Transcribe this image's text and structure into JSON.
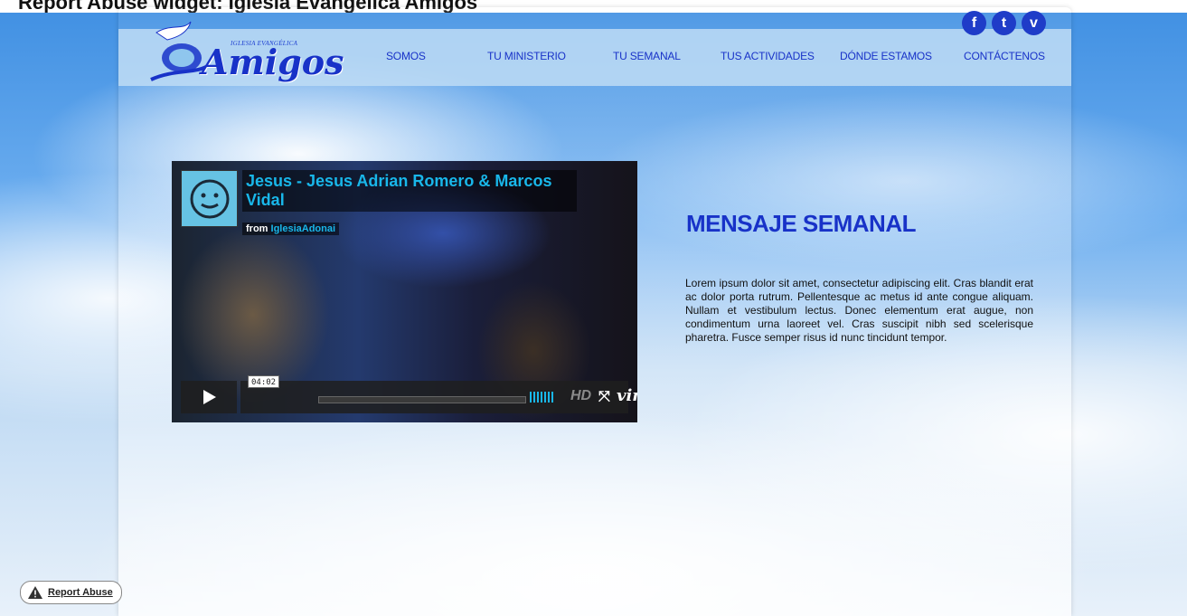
{
  "top_banner": {
    "text": "Report Abuse widget: Iglesia Evangélica Amigos"
  },
  "site": {
    "logo_small": "IGLESIA EVANGÉLICA",
    "logo_big": "Amigos"
  },
  "social": {
    "facebook": "f",
    "twitter": "t",
    "vimeo": "v"
  },
  "nav": [
    "SOMOS",
    "TU MINISTERIO",
    "TU SEMANAL",
    "TUS ACTIVIDADES",
    "DÓNDE ESTAMOS",
    "CONTÁCTENOS"
  ],
  "video": {
    "title": "Jesus - Jesus Adrian Romero & Marcos Vidal",
    "from_label": "from",
    "from_user": "IglesiaAdonai",
    "duration": "04:02",
    "hd_label": "HD",
    "brand": "vimeo"
  },
  "message": {
    "title": "MENSAJE SEMANAL",
    "body": "Lorem ipsum dolor sit amet, consectetur adipiscing elit. Cras blandit erat ac dolor porta rutrum. Pellentesque ac metus id ante congue aliquam. Nullam et vestibulum lectus. Donec elementum erat augue, non condimentum urna laoreet vel. Cras suscipit nibh sed scelerisque pharetra. Fusce semper risus id nunc tincidunt tempor."
  },
  "report": {
    "label": "Report Abuse"
  },
  "colors": {
    "accent": "#1832c8",
    "vimeo_blue": "#19b7ea"
  }
}
